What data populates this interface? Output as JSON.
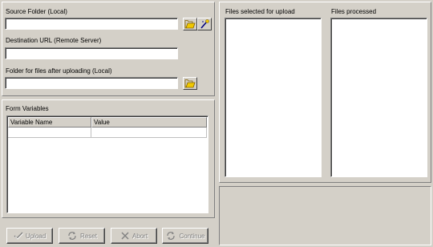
{
  "source": {
    "label": "Source Folder (Local)",
    "value": "",
    "browse_icon": "folder-open-icon",
    "wand_icon": "magic-wand-icon"
  },
  "destination": {
    "label": "Destination URL (Remote Server)",
    "value": ""
  },
  "after_upload": {
    "label": "Folder for files after uploading (Local)",
    "value": "",
    "browse_icon": "folder-open-icon"
  },
  "form_variables": {
    "title": "Form Variables",
    "columns": [
      "Variable Name",
      "Value"
    ]
  },
  "lists": {
    "selected_label": "Files selected for upload",
    "processed_label": "Files processed"
  },
  "buttons": {
    "upload": "Upload",
    "reset": "Reset",
    "abort": "Abort",
    "continue": "Continue"
  },
  "colors": {
    "face": "#d4d0c8",
    "disabled_text": "#808080",
    "folder_yellow": "#f0c800"
  }
}
